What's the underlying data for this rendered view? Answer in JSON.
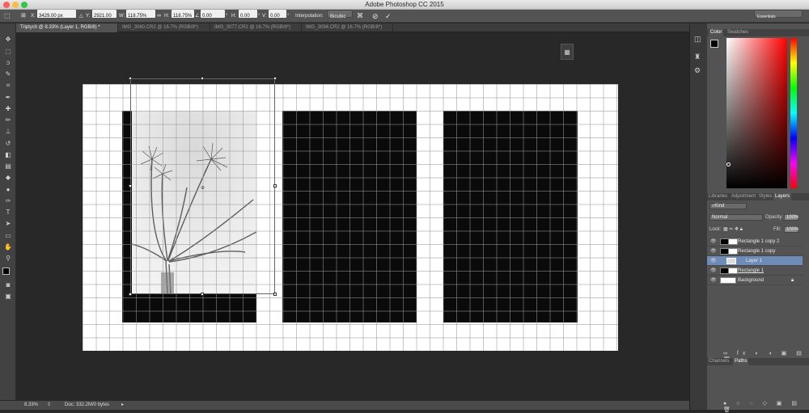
{
  "window": {
    "title": "Adobe Photoshop CC 2015"
  },
  "options": {
    "x_label": "X:",
    "x_value": "3429.00 px",
    "y_label": "Y:",
    "y_value": "2921.00 px",
    "w_label": "W:",
    "w_value": "118.75%",
    "h_label": "H:",
    "h_value": "118.75%",
    "angle_value": "0.00",
    "hskew_label": "H:",
    "hskew_value": "0.00",
    "vskew_label": "V:",
    "vskew_value": "0.00",
    "interp_label": "Interpolation:",
    "interp_value": "Bicubic",
    "workspace": "Essentials"
  },
  "tabs": [
    {
      "label": "Triptych @ 8.33% (Layer 1, RGB/8) *",
      "active": true
    },
    {
      "label": "IMG_3060.CR2 @ 16.7% (RGB/8*)",
      "active": false
    },
    {
      "label": "IMG_3077.CR2 @ 16.7% (RGB/8*)",
      "active": false
    },
    {
      "label": "IMG_3094.CR2 @ 16.7% (RGB/8*)",
      "active": false
    }
  ],
  "status": {
    "zoom": "8.33%",
    "doc": "Doc: 332.2M/0 bytes"
  },
  "color_panel": {
    "tabs": [
      "Color",
      "Swatches"
    ],
    "hue": "#ff0000"
  },
  "layers_panel": {
    "tabs": [
      "Libraries",
      "Adjustment",
      "Styles",
      "Layers"
    ],
    "filter": "Kind",
    "blend_mode": "Normal",
    "opacity_label": "Opacity:",
    "opacity_value": "100%",
    "lock_label": "Lock:",
    "fill_label": "Fill:",
    "fill_value": "100%",
    "layers": [
      {
        "name": "Rectangle 1 copy 2",
        "selected": false
      },
      {
        "name": "Rectangle 1 copy",
        "selected": false
      },
      {
        "name": "Layer 1",
        "selected": true
      },
      {
        "name": "Rectangle 1",
        "selected": false
      },
      {
        "name": "Background",
        "selected": false
      }
    ]
  },
  "bottom_panel": {
    "tabs": [
      "Channels",
      "Paths"
    ]
  }
}
